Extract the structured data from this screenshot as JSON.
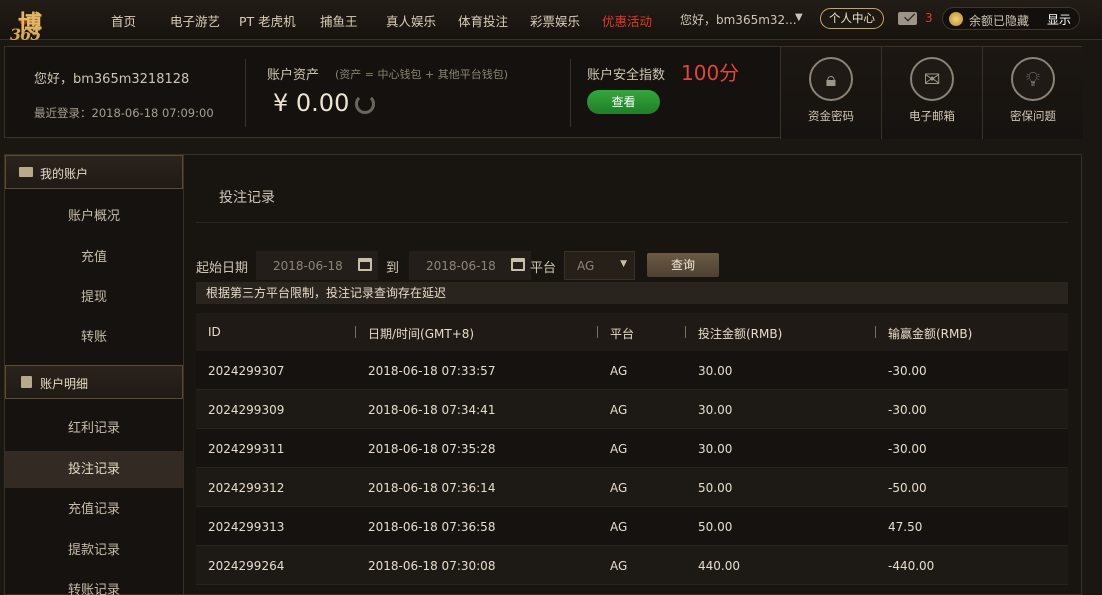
{
  "brand": {
    "logo_text_top": "博",
    "logo_text_bottom": "365"
  },
  "nav": {
    "items": [
      "首页",
      "电子游艺",
      "PT 老虎机",
      "捕鱼王",
      "真人娱乐",
      "体育投注",
      "彩票娱乐",
      "优惠活动"
    ],
    "greeting": "您好，bm365m32...",
    "personal_center": "个人中心",
    "mail_count": "3",
    "balance_hidden": "余额已隐藏",
    "show": "显示"
  },
  "account": {
    "greeting": "您好，bm365m3218128",
    "last_login": "最近登录：2018-06-18 07:09:00",
    "assets_label": "账户资产",
    "assets_note": "(资产 = 中心钱包 + 其他平台钱包)",
    "assets_value": "¥ 0.00",
    "security_label": "账户安全指数",
    "security_score": "100分",
    "check_button": "查看",
    "security_items": [
      {
        "icon": "lock-icon",
        "label": "资金密码"
      },
      {
        "icon": "mail-icon",
        "label": "电子邮箱"
      },
      {
        "icon": "bulb-icon",
        "label": "密保问题"
      }
    ]
  },
  "sidebar": {
    "sections": [
      {
        "title": "我的账户",
        "items": [
          "账户概况",
          "充值",
          "提现",
          "转账"
        ]
      },
      {
        "title": "账户明细",
        "items": [
          "红利记录",
          "投注记录",
          "充值记录",
          "提款记录",
          "转账记录"
        ]
      }
    ],
    "active_item": "投注记录"
  },
  "main": {
    "title": "投注记录",
    "filters": {
      "start_label": "起始日期",
      "start_date": "2018-06-18",
      "to_label": "到",
      "end_date": "2018-06-18",
      "platform_label": "平台",
      "platform_value": "AG",
      "query_button": "查询"
    },
    "notice": "根据第三方平台限制，投注记录查询存在延迟",
    "table": {
      "columns": [
        "ID",
        "日期/时间(GMT+8)",
        "平台",
        "投注金额(RMB)",
        "输赢金额(RMB)"
      ],
      "rows": [
        [
          "2024299307",
          "2018-06-18 07:33:57",
          "AG",
          "30.00",
          "-30.00"
        ],
        [
          "2024299309",
          "2018-06-18 07:34:41",
          "AG",
          "30.00",
          "-30.00"
        ],
        [
          "2024299311",
          "2018-06-18 07:35:28",
          "AG",
          "30.00",
          "-30.00"
        ],
        [
          "2024299312",
          "2018-06-18 07:36:14",
          "AG",
          "50.00",
          "-50.00"
        ],
        [
          "2024299313",
          "2018-06-18 07:36:58",
          "AG",
          "50.00",
          "47.50"
        ],
        [
          "2024299264",
          "2018-06-18 07:30:08",
          "AG",
          "440.00",
          "-440.00"
        ]
      ]
    }
  },
  "colors": {
    "accent_gold": "#c9a55b",
    "promo_red": "#e33a2c",
    "score_red": "#e0463a",
    "button_green": "#2a9434"
  }
}
